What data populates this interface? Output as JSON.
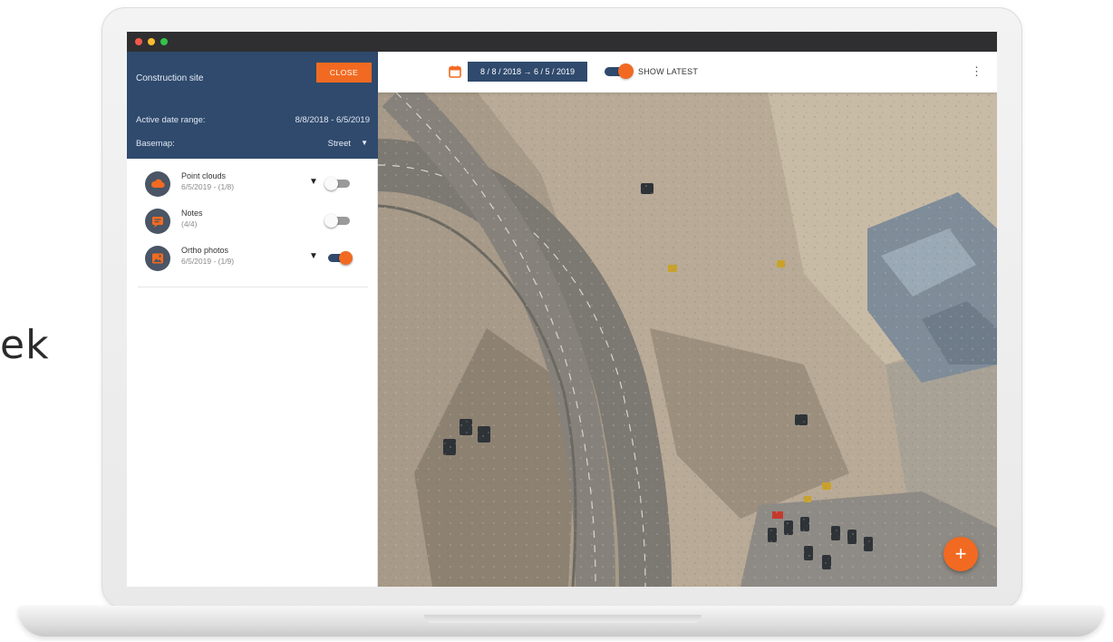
{
  "side_text": "ek",
  "sidebar": {
    "project_title": "Construction site",
    "close_label": "CLOSE",
    "date_range_label": "Active date range:",
    "date_range_value": "8/8/2018 - 6/5/2019",
    "basemap_label": "Basemap:",
    "basemap_value": "Street",
    "layers": [
      {
        "name": "Point clouds",
        "meta": "6/5/2019 - (1/8)",
        "icon": "cloud-icon",
        "enabled": false,
        "expandable": true
      },
      {
        "name": "Notes",
        "meta": "(4/4)",
        "icon": "note-icon",
        "enabled": false,
        "expandable": false
      },
      {
        "name": "Ortho photos",
        "meta": "6/5/2019 - (1/9)",
        "icon": "image-icon",
        "enabled": true,
        "expandable": true
      }
    ]
  },
  "topbar": {
    "date_range": "8 / 8 / 2018  →  6 / 5 / 2019",
    "show_latest_label": "SHOW LATEST",
    "show_latest_enabled": true,
    "menu_icon": "more-vertical-icon",
    "calendar_icon": "calendar-icon"
  },
  "fab": {
    "label": "+",
    "icon": "add-icon"
  },
  "colors": {
    "accent": "#f26a21",
    "primary": "#2f4a6d",
    "titlebar": "#2f2f31"
  }
}
